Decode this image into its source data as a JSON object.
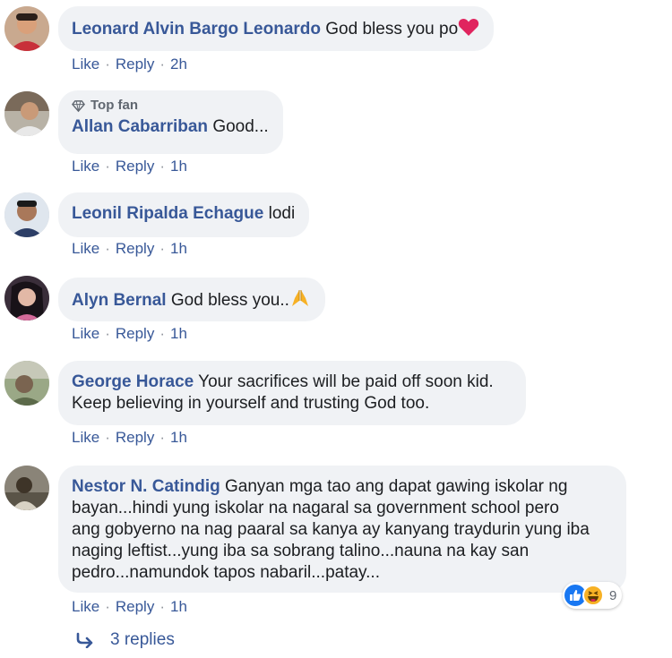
{
  "comments": [
    {
      "author": "Leonard Alvin Bargo Leonardo",
      "text": "God bless you po",
      "emoji": "heart",
      "like": "Like",
      "reply": "Reply",
      "time": "2h"
    },
    {
      "badge": "Top fan",
      "author": "Allan Cabarriban",
      "text": "Good...",
      "like": "Like",
      "reply": "Reply",
      "time": "1h"
    },
    {
      "author": "Leonil Ripalda Echague",
      "text": "lodi",
      "like": "Like",
      "reply": "Reply",
      "time": "1h"
    },
    {
      "author": "Alyn Bernal",
      "text": "God bless you..",
      "emoji": "folded-hands",
      "like": "Like",
      "reply": "Reply",
      "time": "1h"
    },
    {
      "author": "George Horace",
      "text_line1": "Your sacrifices will be paid off soon kid.",
      "text_line2": "Keep believing in yourself and trusting God too.",
      "like": "Like",
      "reply": "Reply",
      "time": "1h"
    },
    {
      "author": "Nestor N. Catindig",
      "text_line1": "Ganyan mga tao ang dapat gawing iskolar ng",
      "text_line2": "bayan...hindi yung iskolar na nagaral sa government school pero",
      "text_line3": "ang gobyerno na nag paaral sa kanya ay kanyang traydurin yung iba",
      "text_line4": "naging leftist...yung iba sa sobrang talino...nauna na kay san",
      "text_line5": "pedro...namundok tapos nabaril...patay...",
      "like": "Like",
      "reply": "Reply",
      "time": "1h",
      "reactions": {
        "types": [
          "like",
          "haha"
        ],
        "count": "9"
      }
    }
  ],
  "replies_link": "3 replies",
  "colors": {
    "link": "#385898",
    "bubble": "#f0f2f5",
    "like_blue": "#1877f2",
    "haha_yellow": "#f7b125"
  }
}
